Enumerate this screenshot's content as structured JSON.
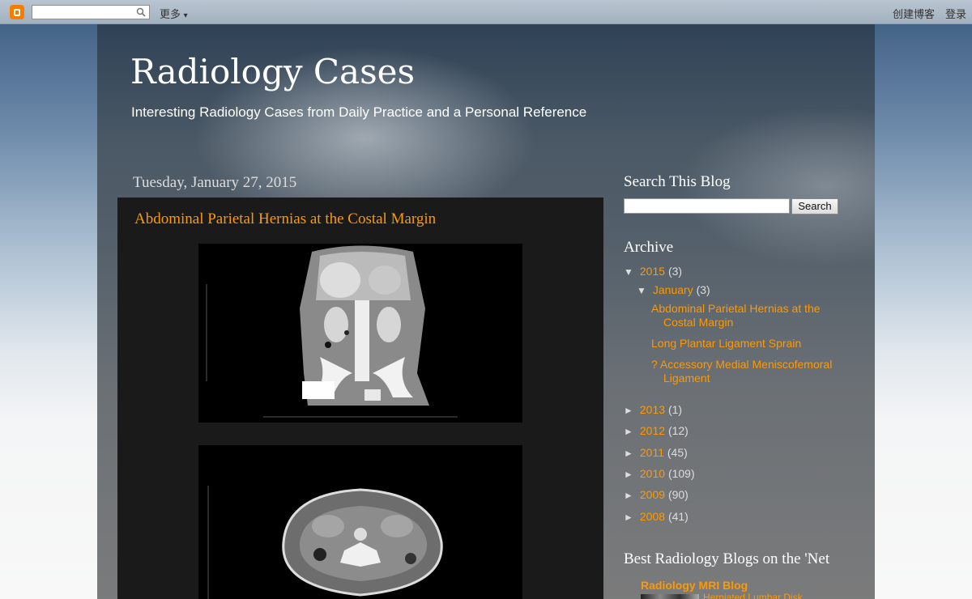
{
  "navbar": {
    "search_placeholder": "",
    "more_label": "更多",
    "more_arrow": "▾",
    "create_blog": "创建博客",
    "login": "登录"
  },
  "header": {
    "title": "Radiology Cases",
    "description": "Interesting Radiology Cases from Daily Practice and a Personal Reference"
  },
  "main": {
    "date": "Tuesday, January 27, 2015",
    "post_title": "Abdominal Parietal Hernias at the Costal Margin"
  },
  "sidebar": {
    "search_title": "Search This Blog",
    "search_button": "Search",
    "archive_title": "Archive",
    "archive": [
      {
        "tri": "▼",
        "year": "2015",
        "count": "(3)"
      },
      {
        "tri": "▼",
        "year": "January",
        "count": "(3)"
      },
      {
        "tri": "►",
        "year": "2013",
        "count": "(1)"
      },
      {
        "tri": "►",
        "year": "2012",
        "count": "(12)"
      },
      {
        "tri": "►",
        "year": "2011",
        "count": "(45)"
      },
      {
        "tri": "►",
        "year": "2010",
        "count": "(109)"
      },
      {
        "tri": "►",
        "year": "2009",
        "count": "(90)"
      },
      {
        "tri": "►",
        "year": "2008",
        "count": "(41)"
      }
    ],
    "archive_posts": [
      "Abdominal Parietal Hernias at the Costal Margin",
      "Long Plantar Ligament Sprain",
      "? Accessory Medial Meniscofemoral Ligament"
    ],
    "blogroll_title": "Best Radiology Blogs on the 'Net",
    "blogroll_name": "Radiology MRI Blog",
    "blogroll_post": "Herniated Lumbar Disk"
  },
  "colors": {
    "link": "#ff9900",
    "post_bg": "#1a1a1a"
  }
}
